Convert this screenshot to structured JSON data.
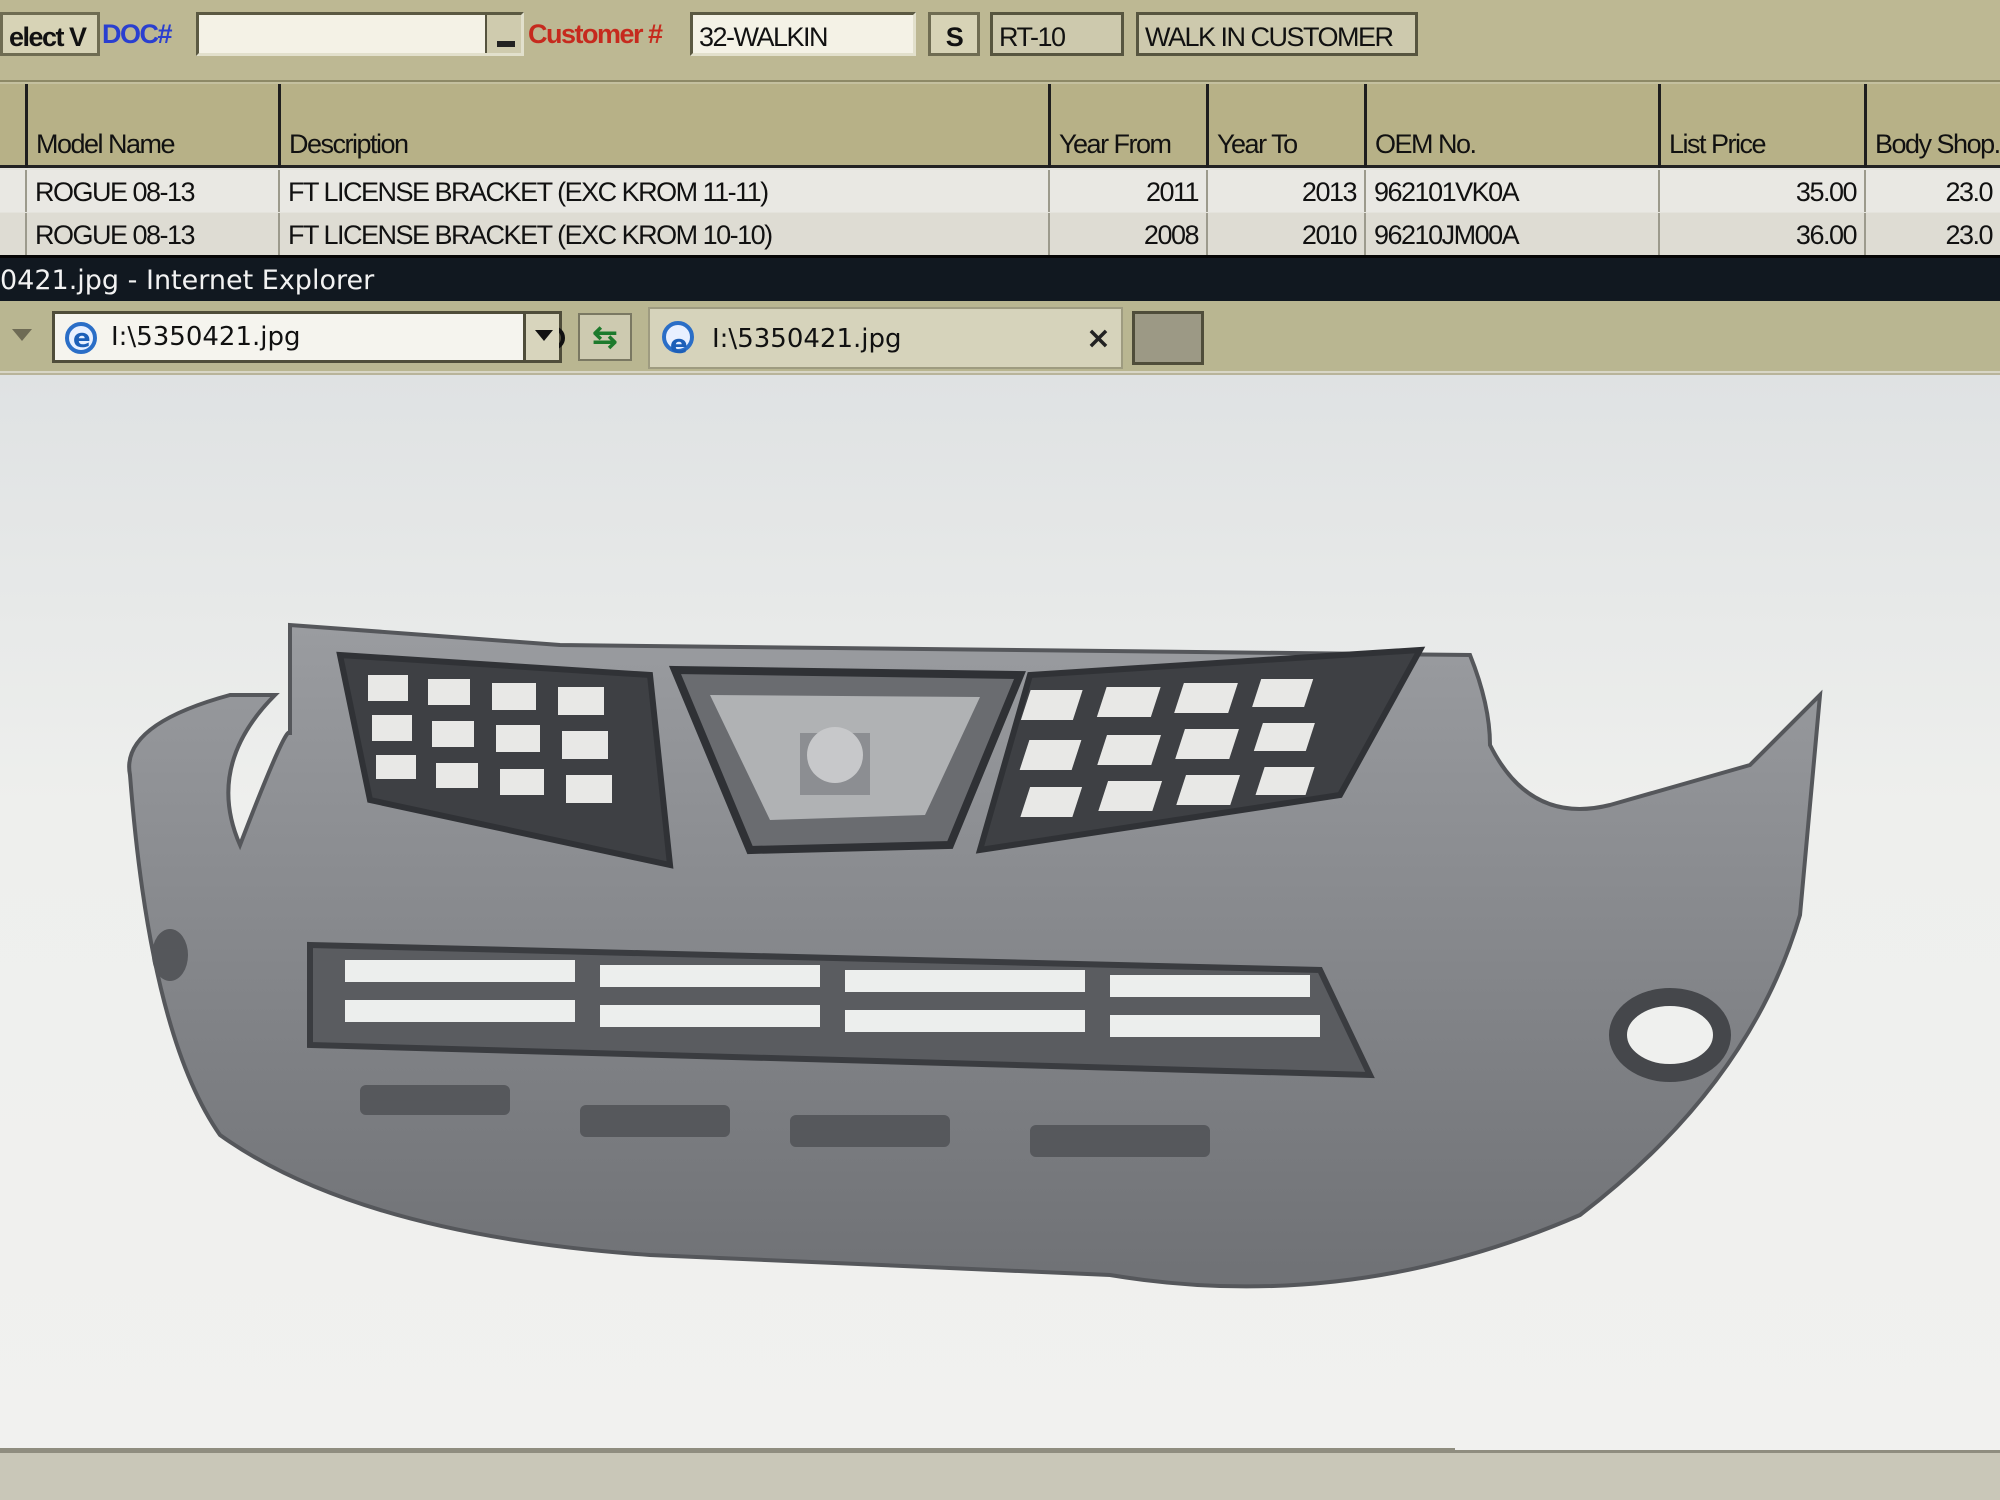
{
  "toolbar": {
    "select_button": "elect V",
    "doc_label": "DOC#",
    "doc_value": "",
    "customer_label": "Customer #",
    "customer_value": "32-WALKIN",
    "s_button": "S",
    "route_value": "RT-10",
    "customer_name": "WALK IN CUSTOMER"
  },
  "grid": {
    "columns": [
      "Model Name",
      "Description",
      "Year From",
      "Year To",
      "OEM No.",
      "List Price",
      "Body Shop."
    ],
    "rows": [
      [
        "ROGUE 08-13",
        "FT LICENSE BRACKET (EXC KROM 11-11)",
        "2011",
        "2013",
        "962101VK0A",
        "35.00",
        "23.0"
      ],
      [
        "ROGUE 08-13",
        "FT LICENSE BRACKET (EXC KROM 10-10)",
        "2008",
        "2010",
        "96210JM00A",
        "36.00",
        "23.0"
      ]
    ]
  },
  "browser": {
    "title": "0421.jpg - Internet Explorer",
    "address": "I:\\5350421.jpg",
    "tab_label": "I:\\5350421.jpg",
    "tab_close": "×"
  },
  "icons": {
    "address_page": "ie-page-icon",
    "search": "search-icon",
    "refresh": "refresh-icon",
    "tab": "ie-logo-icon",
    "close": "close-icon"
  },
  "colors": {
    "toolbar_bg": "#bdb893",
    "header_bg": "#b7b187",
    "doc_label": "#2a3fd0",
    "customer_label": "#c62a1e",
    "bumper": "#8a8c90"
  }
}
